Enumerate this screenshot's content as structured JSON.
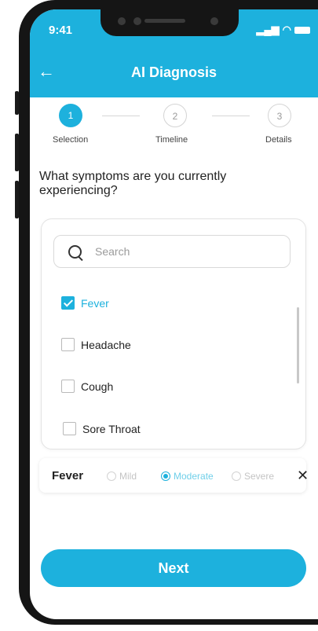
{
  "status_bar": {
    "time": "9:41"
  },
  "header": {
    "title": "AI Diagnosis"
  },
  "steps": [
    {
      "number": "1",
      "label": "Selection",
      "active": true
    },
    {
      "number": "2",
      "label": "Timeline",
      "active": false
    },
    {
      "number": "3",
      "label": "Details",
      "active": false
    }
  ],
  "question": "What symptoms are you currently experiencing?",
  "search": {
    "placeholder": "Search"
  },
  "symptoms": [
    {
      "label": "Fever",
      "checked": true
    },
    {
      "label": "Headache",
      "checked": false
    },
    {
      "label": "Cough",
      "checked": false
    },
    {
      "label": "Sore Throat",
      "checked": false
    }
  ],
  "severity": {
    "symptom": "Fever",
    "options": [
      "Mild",
      "Moderate",
      "Severe"
    ],
    "selected": "Moderate",
    "close_symbol": "✕"
  },
  "next_button": {
    "label": "Next"
  },
  "colors": {
    "accent": "#1db1dd",
    "frame": "#151515"
  }
}
